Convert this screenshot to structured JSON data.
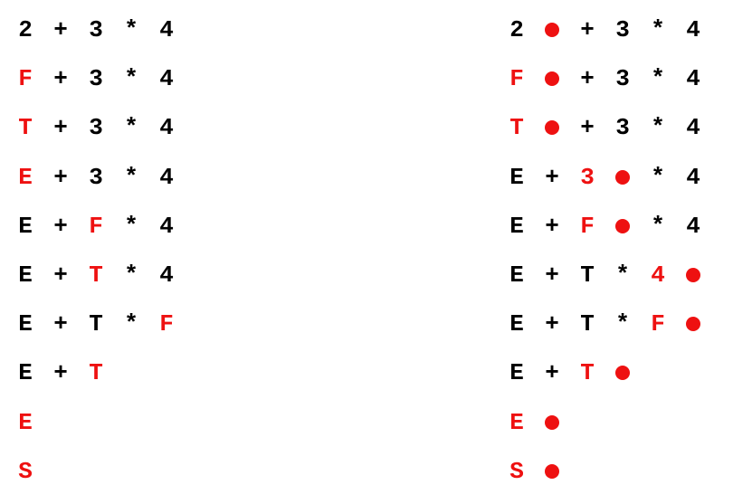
{
  "colors": {
    "default": "#000000",
    "highlight": "#ee1111"
  },
  "left_column": {
    "rows": [
      {
        "tokens": [
          {
            "text": "2",
            "hl": false
          },
          {
            "text": "+",
            "hl": false
          },
          {
            "text": "3",
            "hl": false
          },
          {
            "text": "*",
            "hl": false
          },
          {
            "text": "4",
            "hl": false
          }
        ]
      },
      {
        "tokens": [
          {
            "text": "F",
            "hl": true
          },
          {
            "text": "+",
            "hl": false
          },
          {
            "text": "3",
            "hl": false
          },
          {
            "text": "*",
            "hl": false
          },
          {
            "text": "4",
            "hl": false
          }
        ]
      },
      {
        "tokens": [
          {
            "text": "T",
            "hl": true
          },
          {
            "text": "+",
            "hl": false
          },
          {
            "text": "3",
            "hl": false
          },
          {
            "text": "*",
            "hl": false
          },
          {
            "text": "4",
            "hl": false
          }
        ]
      },
      {
        "tokens": [
          {
            "text": "E",
            "hl": true
          },
          {
            "text": "+",
            "hl": false
          },
          {
            "text": "3",
            "hl": false
          },
          {
            "text": "*",
            "hl": false
          },
          {
            "text": "4",
            "hl": false
          }
        ]
      },
      {
        "tokens": [
          {
            "text": "E",
            "hl": false
          },
          {
            "text": "+",
            "hl": false
          },
          {
            "text": "F",
            "hl": true
          },
          {
            "text": "*",
            "hl": false
          },
          {
            "text": "4",
            "hl": false
          }
        ]
      },
      {
        "tokens": [
          {
            "text": "E",
            "hl": false
          },
          {
            "text": "+",
            "hl": false
          },
          {
            "text": "T",
            "hl": true
          },
          {
            "text": "*",
            "hl": false
          },
          {
            "text": "4",
            "hl": false
          }
        ]
      },
      {
        "tokens": [
          {
            "text": "E",
            "hl": false
          },
          {
            "text": "+",
            "hl": false
          },
          {
            "text": "T",
            "hl": false
          },
          {
            "text": "*",
            "hl": false
          },
          {
            "text": "F",
            "hl": true
          }
        ]
      },
      {
        "tokens": [
          {
            "text": "E",
            "hl": false
          },
          {
            "text": "+",
            "hl": false
          },
          {
            "text": "T",
            "hl": true
          }
        ]
      },
      {
        "tokens": [
          {
            "text": "E",
            "hl": true
          }
        ]
      },
      {
        "tokens": [
          {
            "text": "S",
            "hl": true
          }
        ]
      }
    ]
  },
  "right_column": {
    "rows": [
      {
        "tokens": [
          {
            "text": "2",
            "hl": false
          },
          {
            "dot": true
          },
          {
            "text": "+",
            "hl": false
          },
          {
            "text": "3",
            "hl": false
          },
          {
            "text": "*",
            "hl": false
          },
          {
            "text": "4",
            "hl": false
          }
        ]
      },
      {
        "tokens": [
          {
            "text": "F",
            "hl": true
          },
          {
            "dot": true
          },
          {
            "text": "+",
            "hl": false
          },
          {
            "text": "3",
            "hl": false
          },
          {
            "text": "*",
            "hl": false
          },
          {
            "text": "4",
            "hl": false
          }
        ]
      },
      {
        "tokens": [
          {
            "text": "T",
            "hl": true
          },
          {
            "dot": true
          },
          {
            "text": "+",
            "hl": false
          },
          {
            "text": "3",
            "hl": false
          },
          {
            "text": "*",
            "hl": false
          },
          {
            "text": "4",
            "hl": false
          }
        ]
      },
      {
        "tokens": [
          {
            "text": "E",
            "hl": false
          },
          {
            "text": "+",
            "hl": false
          },
          {
            "text": "3",
            "hl": true
          },
          {
            "dot": true
          },
          {
            "text": "*",
            "hl": false
          },
          {
            "text": "4",
            "hl": false
          }
        ]
      },
      {
        "tokens": [
          {
            "text": "E",
            "hl": false
          },
          {
            "text": "+",
            "hl": false
          },
          {
            "text": "F",
            "hl": true
          },
          {
            "dot": true
          },
          {
            "text": "*",
            "hl": false
          },
          {
            "text": "4",
            "hl": false
          }
        ]
      },
      {
        "tokens": [
          {
            "text": "E",
            "hl": false
          },
          {
            "text": "+",
            "hl": false
          },
          {
            "text": "T",
            "hl": false
          },
          {
            "text": "*",
            "hl": false
          },
          {
            "text": "4",
            "hl": true
          },
          {
            "dot": true
          }
        ]
      },
      {
        "tokens": [
          {
            "text": "E",
            "hl": false
          },
          {
            "text": "+",
            "hl": false
          },
          {
            "text": "T",
            "hl": false
          },
          {
            "text": "*",
            "hl": false
          },
          {
            "text": "F",
            "hl": true
          },
          {
            "dot": true
          }
        ]
      },
      {
        "tokens": [
          {
            "text": "E",
            "hl": false
          },
          {
            "text": "+",
            "hl": false
          },
          {
            "text": "T",
            "hl": true
          },
          {
            "dot": true
          }
        ]
      },
      {
        "tokens": [
          {
            "text": "E",
            "hl": true
          },
          {
            "dot": true
          }
        ]
      },
      {
        "tokens": [
          {
            "text": "S",
            "hl": true
          },
          {
            "dot": true
          }
        ]
      }
    ]
  }
}
